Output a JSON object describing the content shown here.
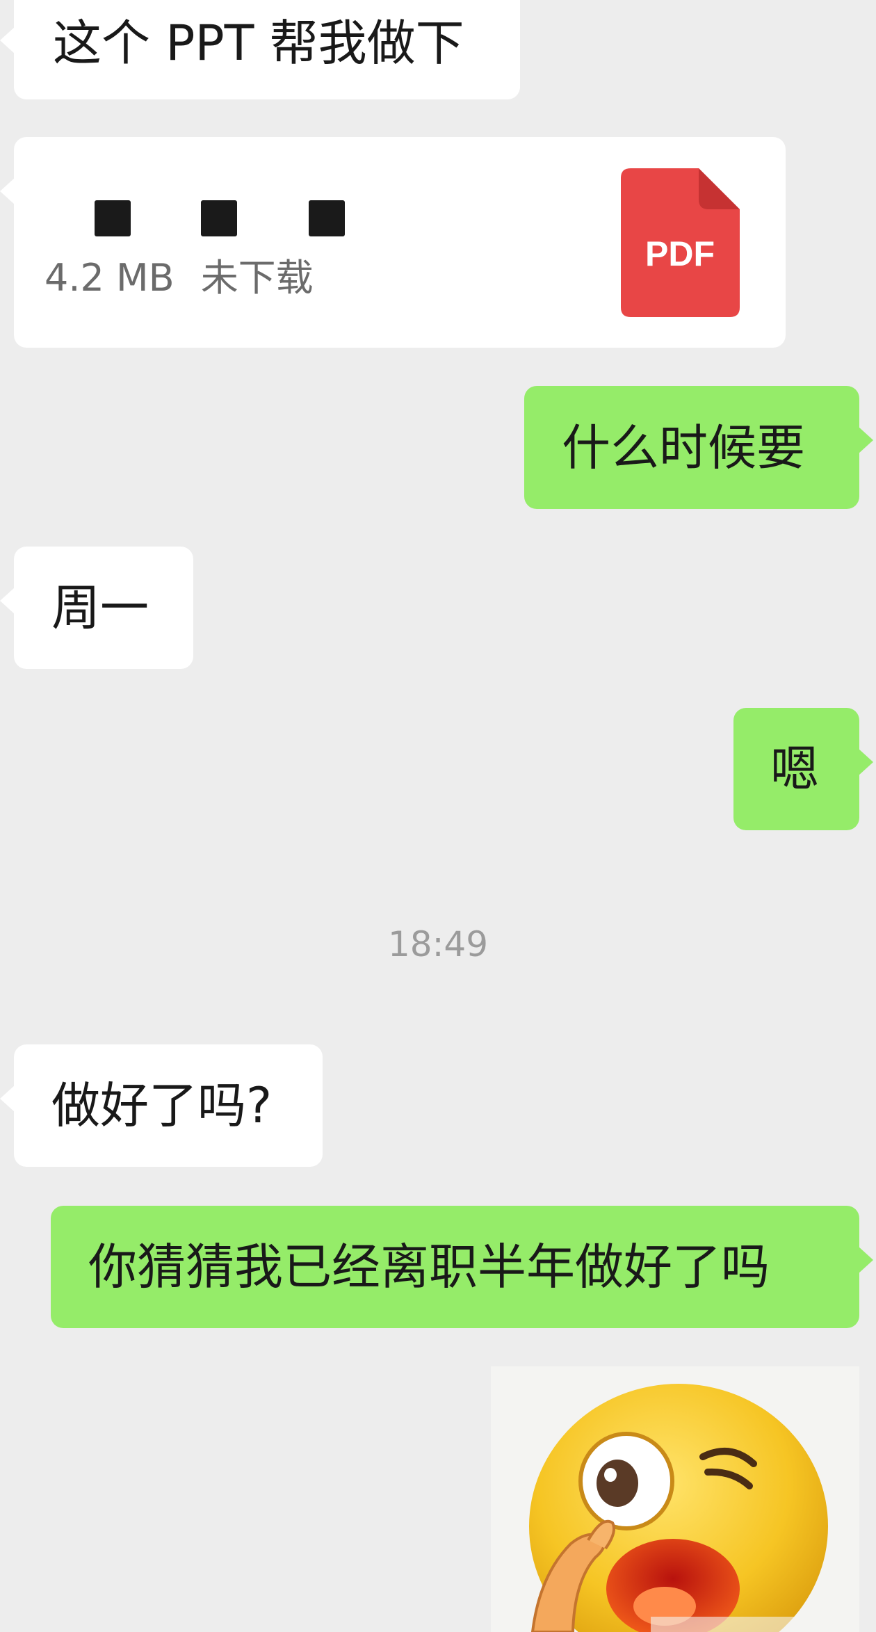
{
  "messages": [
    {
      "id": "msg1",
      "side": "left",
      "type": "text",
      "text": "这个 PPT 帮我做下"
    },
    {
      "id": "msg-file",
      "side": "left",
      "type": "file",
      "file": {
        "size": "4.2 MB",
        "status": "未下载",
        "icon_label": "PDF",
        "icon": "pdf-file-icon",
        "icon_color": "#e84646"
      }
    },
    {
      "id": "msg2",
      "side": "right",
      "type": "text",
      "text": "什么时候要"
    },
    {
      "id": "msg3",
      "side": "left",
      "type": "text",
      "text": "周一"
    },
    {
      "id": "msg4",
      "side": "right",
      "type": "text",
      "text": "嗯"
    },
    {
      "id": "msg5",
      "side": "left",
      "type": "text",
      "text": "做好了吗?"
    },
    {
      "id": "msg6",
      "side": "right",
      "type": "text",
      "text": "你猜猜我已经离职半年做好了吗"
    },
    {
      "id": "sticker",
      "side": "right",
      "type": "sticker",
      "icon": "winking-emoji-sticker"
    }
  ],
  "timestamp": "18:49",
  "colors": {
    "background": "#ededed",
    "incoming_bubble": "#ffffff",
    "outgoing_bubble": "#95ec69",
    "pdf_red": "#e84646"
  }
}
